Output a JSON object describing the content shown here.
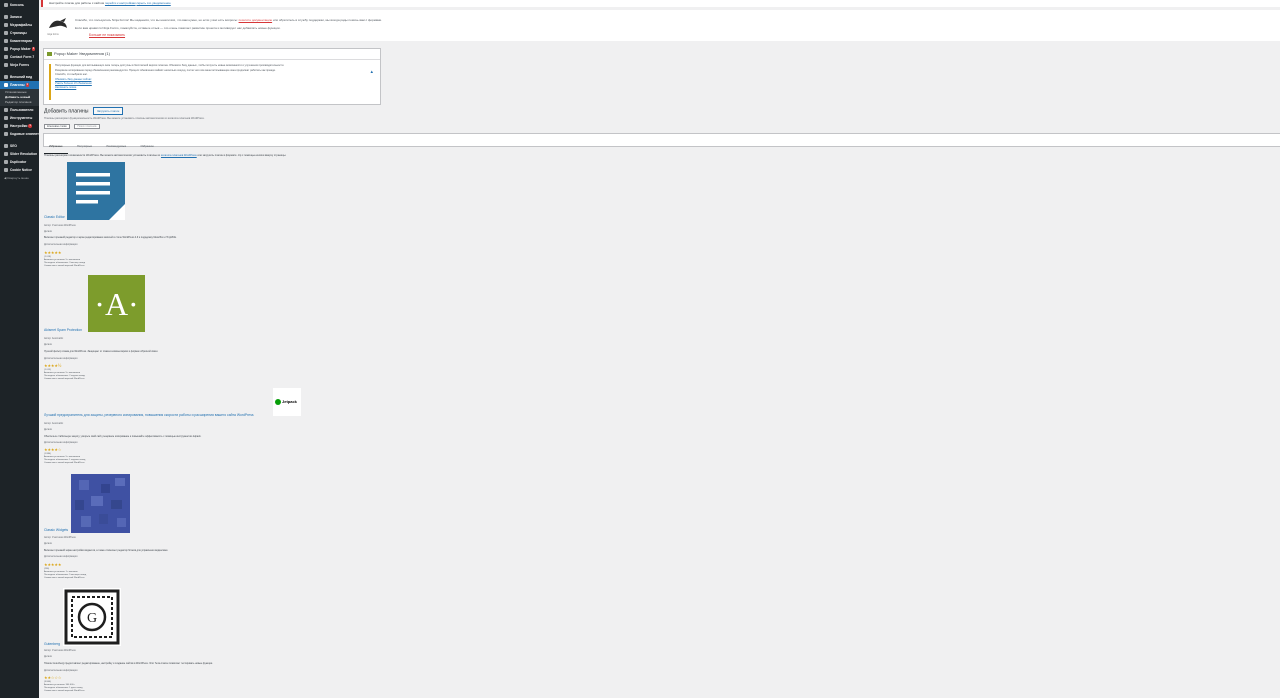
{
  "sidebar": {
    "items": [
      {
        "label": "Консоль",
        "active": false
      },
      {
        "label": "Записи",
        "active": false
      },
      {
        "label": "Медиафайлы",
        "active": false
      },
      {
        "label": "Страницы",
        "active": false
      },
      {
        "label": "Комментарии",
        "active": false
      },
      {
        "label": "Popup Maker",
        "badge": "1",
        "active": false
      },
      {
        "label": "Contact Form 7",
        "active": false
      },
      {
        "label": "Ninja Forms",
        "active": false
      },
      {
        "label": "Внешний вид",
        "active": false
      },
      {
        "label": "Плагины",
        "badge": "1",
        "active": true
      }
    ],
    "submenu": [
      "Установленные",
      "Добавить новый",
      "Редактор плагинов"
    ],
    "items2": [
      {
        "label": "Пользователи"
      },
      {
        "label": "Инструменты"
      },
      {
        "label": "Настройки",
        "badge": "1"
      },
      {
        "label": "Кодовые сниппеты"
      },
      {
        "label": "SEO"
      },
      {
        "label": "Slider Revolution"
      },
      {
        "label": "Duplicator"
      },
      {
        "label": "Cookie Notice"
      }
    ],
    "collapse_label": "Свернуть меню"
  },
  "top_notice": {
    "text": "Настройте плагин для работы с сайтом",
    "link1": "перейти к настройкам",
    "link2": "скрыть это уведомление"
  },
  "promo": {
    "logo_caption": "ninja forms",
    "line1": "Спасибо, что пользуетесь Ninja Forms! Мы надеемся, что вы нашли всё, что вам нужно, но если у вас есть вопросы:",
    "line1_link": "посетите документацию",
    "line1_rest": "или обратитесь в службу поддержки, мы всегда рады помочь вам с формами.",
    "line2": "Если вам нравится Ninja Forms, пожалуйста, оставьте отзыв — это очень помогает развитию проекта и мотивирует нас добавлять новые функции.",
    "dismiss": "Больше не показывать"
  },
  "update_box": {
    "title": "Popup Maker Уведомления (1)",
    "p1": "Популярные функции для всплывающих окон теперь доступны в бесплатной версии плагина. Обновите базу данных, чтобы получить новые возможности и улучшения производительности.",
    "p2": "Резервное копирование перед обновлением рекомендуется. Процесс обновления займёт несколько секунд, после чего все ваши всплывающие окна продолжат работать как прежде.",
    "p3": "Спасибо, что выбрали нас.",
    "link1": "Обновить базу данных сейчас",
    "link2": "Узнать больше об обновлении",
    "link3": "Напомнить позже"
  },
  "page": {
    "title": "Добавить плагины",
    "upload_button": "Загрузить плагин",
    "subtext": "Плагины расширяют функциональность WordPress. Вы можете установить плагины автоматически из каталога плагинов WordPress.",
    "filter_select": "Ключевое слово",
    "filter_search": "Поиск плагинов...",
    "tabs": [
      "Избранные",
      "Популярные",
      "Рекомендуемые",
      "Избранное"
    ],
    "intro": "Плагины расширяют возможности WordPress. Вы можете автоматически установить плагины из",
    "intro_link": "каталога плагинов WordPress",
    "intro_rest": "или загрузить плагин в формате .zip с помощью кнопки вверху страницы."
  },
  "plugins": [
    {
      "name": "Classic Editor",
      "author": "Автор: Участники WordPress",
      "meta2": "Детали",
      "desc": "Включает прежний редактор и экран редактирования записей в стиле WordPress 4.9 и поддержку Meta Box и TinyMCE.",
      "more": "Дополнительная информация",
      "stars": "★★★★★",
      "ratings": "(1 018)",
      "installs": "Активных установок: 5+ миллионов",
      "updated": "Последнее обновление: 3 месяца назад",
      "compat": "Совместим с вашей версией WordPress",
      "thumb_color": "#2e74a1"
    },
    {
      "name": "Akismet Spam Protection",
      "author": "Автор: Automattic",
      "meta2": "Детали",
      "desc": "Лучший фильтр спама для WordPress. Защищает от спама в комментариях и формах обратной связи.",
      "more": "Дополнительная информация",
      "stars": "★★★★½",
      "ratings": "(1 013)",
      "installs": "Активных установок: 5+ миллионов",
      "updated": "Последнее обновление: 2 недели назад",
      "compat": "Совместим с вашей версией WordPress",
      "thumb_color": "#7d9c2c",
      "thumb_letter": "·A·"
    },
    {
      "name": "Лучший предохранитель для защиты, резервного копирования, повышения скорости работы и расширения вашего сайта WordPress",
      "author": "Автор: Automattic",
      "meta2": "Детали",
      "desc": "Обеспечьте стабильную защиту, ускорьте свой сайт, резервное копирование и повышайте эффективность с помощью инструментов Jetpack.",
      "more": "Дополнительная информация",
      "stars": "★★★★☆",
      "ratings": "(1 884)",
      "installs": "Активных установок: 5+ миллионов",
      "updated": "Последнее обновление: 1 неделю назад",
      "compat": "Совместим с вашей версией WordPress",
      "logo_text": "Jetpack"
    },
    {
      "name": "Classic Widgets",
      "author": "Автор: Участники WordPress",
      "meta2": "Детали",
      "desc": "Включает прежний экран настройки виджетов, а также отключает редактор блоков для управления виджетами.",
      "more": "Дополнительная информация",
      "stars": "★★★★★",
      "ratings": "(236)",
      "installs": "Активных установок: 1+ миллион",
      "updated": "Последнее обновление: 5 месяцев назад",
      "compat": "Совместим с вашей версией WordPress",
      "thumb_color": "#3f51a3"
    },
    {
      "name": "Gutenberg",
      "author": "Автор: Участники WordPress",
      "meta2": "Детали",
      "desc": "Плагин Gutenberg предоставляет редактирование, настройку и создание сайтов в WordPress. Этот бета-плагин позволяет тестировать новые функции.",
      "more": "Дополнительная информация",
      "stars": "★★☆☆☆",
      "ratings": "(3 846)",
      "installs": "Активных установок: 300 000+",
      "updated": "Последнее обновление: 1 день назад",
      "compat": "Совместим с вашей версией WordPress",
      "logo_letter": "G"
    }
  ]
}
